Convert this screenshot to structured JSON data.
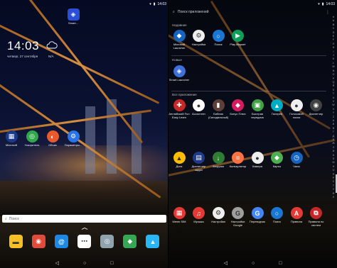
{
  "left": {
    "status": {
      "left": "",
      "right": "14:03"
    },
    "clock": "14:03",
    "date": "четверг, 27 сентября",
    "weather": "N/A",
    "top_app": {
      "label": "Smart...",
      "color": "#2a4fd6"
    },
    "row_apps": [
      {
        "label": "Microsoft",
        "color": "#1b3a8a",
        "glyph": "▦"
      },
      {
        "label": "Ускоритель",
        "color": "#2ea84a",
        "glyph": "◎"
      },
      {
        "label": "Обоих",
        "color": "#e85a2c",
        "glyph": "◐"
      },
      {
        "label": "Параметры...",
        "color": "#2a73e8",
        "glyph": "⚙"
      }
    ],
    "search_placeholder": "Поиск",
    "dock": [
      {
        "name": "messages-icon",
        "color": "#f4c026",
        "glyph": "▬"
      },
      {
        "name": "chrome-icon",
        "color": "#e24a3b",
        "glyph": "◉"
      },
      {
        "name": "email-icon",
        "color": "#1e88e5",
        "glyph": "@"
      },
      {
        "name": "apps-grid-icon",
        "color": "#ffffff",
        "glyph": "⋯"
      },
      {
        "name": "camera-icon",
        "color": "#90a4ae",
        "glyph": "◎"
      },
      {
        "name": "maps-icon",
        "color": "#34a853",
        "glyph": "◆"
      },
      {
        "name": "gallery-icon",
        "color": "#29b6f6",
        "glyph": "▲"
      }
    ]
  },
  "right": {
    "status": {
      "right": "14:03"
    },
    "search_placeholder": "Поиск приложений",
    "sections": {
      "recent": "Недавние",
      "new": "Новые",
      "all": "Все приложения"
    },
    "recent": [
      {
        "label": "Microsoft Launcher",
        "color": "#1565c0",
        "glyph": "◆"
      },
      {
        "label": "Настройки",
        "color": "#eeeeee",
        "glyph": "⚙"
      },
      {
        "label": "Поиск",
        "color": "#1976d2",
        "glyph": "○"
      },
      {
        "label": "Play Маркет",
        "color": "#0f9d58",
        "glyph": "▶"
      }
    ],
    "new": [
      {
        "label": "Smart Launcher",
        "color": "#3f6fd8",
        "glyph": "◈"
      }
    ],
    "all_row1": [
      {
        "label": "Английский Fun Easy Learn",
        "color": "#c62828",
        "glyph": "✚"
      },
      {
        "label": "Ассистент",
        "color": "#ffffff",
        "glyph": "●"
      },
      {
        "label": "Библия (Синодальный)",
        "color": "#5d4037",
        "glyph": "▮"
      },
      {
        "label": "Бонус Плюс",
        "color": "#d81b60",
        "glyph": "◆"
      },
      {
        "label": "Быстрая передача",
        "color": "#43a047",
        "glyph": "▣"
      },
      {
        "label": "Галерея",
        "color": "#00acc1",
        "glyph": "▲"
      },
      {
        "label": "Голосовой поиск",
        "color": "#eeeeee",
        "glyph": "●"
      },
      {
        "label": "Диспетчер",
        "color": "#424242",
        "glyph": "◉"
      }
    ],
    "all_row2": [
      {
        "label": "Диск",
        "color": "#fbbc04",
        "glyph": "▲"
      },
      {
        "label": "Диспетчер задач",
        "color": "#1e3a8a",
        "glyph": "▤"
      },
      {
        "label": "Загрузки",
        "color": "#2e7d32",
        "glyph": "↓"
      },
      {
        "label": "Калькулятор",
        "color": "#ff7043",
        "glyph": "="
      },
      {
        "label": "Камера",
        "color": "#eeeeee",
        "glyph": "●"
      },
      {
        "label": "Карты",
        "color": "#4caf50",
        "glyph": "◆"
      },
      {
        "label": "Часы",
        "color": "#1565c0",
        "glyph": "◷"
      }
    ],
    "all_row3": [
      {
        "label": "Меню SIM",
        "color": "#e53935",
        "glyph": "▦"
      },
      {
        "label": "Музыка",
        "color": "#e53935",
        "glyph": "♫"
      },
      {
        "label": "Настройки",
        "color": "#eeeeee",
        "glyph": "⚙"
      },
      {
        "label": "Настройки Google",
        "color": "#9e9e9e",
        "glyph": "G"
      },
      {
        "label": "Переводчик",
        "color": "#4285f4",
        "glyph": "G"
      },
      {
        "label": "Поиск",
        "color": "#1976d2",
        "glyph": "○"
      },
      {
        "label": "Правила",
        "color": "#e53935",
        "glyph": "A"
      },
      {
        "label": "Правила по систем",
        "color": "#c62828",
        "glyph": "⧉"
      }
    ],
    "alphabet": [
      "#",
      "A",
      "B",
      "C",
      "D",
      "E",
      "F",
      "G",
      "H",
      "I",
      "J",
      "K",
      "L",
      "M",
      "N",
      "O",
      "P",
      "Q",
      "R",
      "S",
      "T",
      "U",
      "V",
      "W",
      "X",
      "Y",
      "Z",
      "А",
      "Б",
      "В",
      "Г",
      "Д",
      "Е",
      "Ж",
      "З",
      "И",
      "К",
      "Л",
      "М",
      "Н",
      "О",
      "П",
      "Р",
      "С",
      "Т",
      "У",
      "Ф",
      "Х"
    ]
  },
  "nav": {
    "back": "◁",
    "home": "○",
    "recents": "□"
  }
}
